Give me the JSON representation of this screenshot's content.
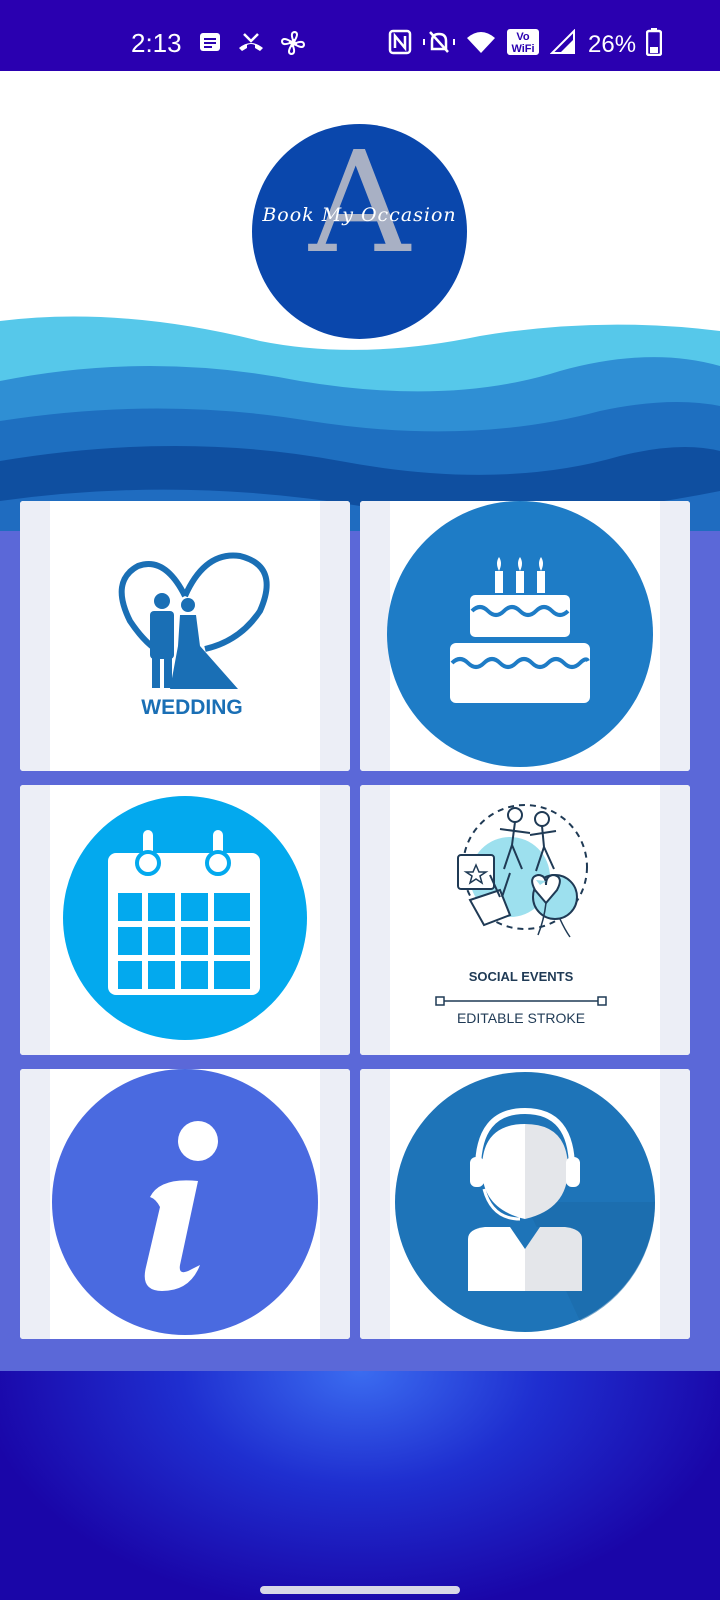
{
  "status_bar": {
    "time": "2:13",
    "battery": "26%",
    "icons": [
      "message-icon",
      "missed-call-icon",
      "fan-icon",
      "nfc-icon",
      "mute-icon",
      "wifi-icon",
      "vowifi-icon",
      "signal-icon",
      "battery-icon"
    ],
    "vowifi_top": "Vo",
    "vowifi_bottom": "WiFi"
  },
  "logo": {
    "letter": "A",
    "text": "Book My Occasion"
  },
  "tiles": [
    {
      "name": "wedding",
      "label": "WEDDING"
    },
    {
      "name": "birthday",
      "label": ""
    },
    {
      "name": "calendar",
      "label": ""
    },
    {
      "name": "social-events",
      "label": "SOCIAL EVENTS",
      "sublabel": "EDITABLE STROKE"
    },
    {
      "name": "info",
      "label": ""
    },
    {
      "name": "support",
      "label": ""
    }
  ],
  "colors": {
    "status_bar": "#2a00b0",
    "grid_bg": "#5b68d8",
    "logo_bg": "#0a47ac",
    "wedding_blue": "#1a6fb5",
    "cake_circle": "#1e7cc6",
    "calendar_circle": "#03a9ee",
    "info_circle": "#4a6ae0",
    "support_circle": "#1e74b8"
  }
}
